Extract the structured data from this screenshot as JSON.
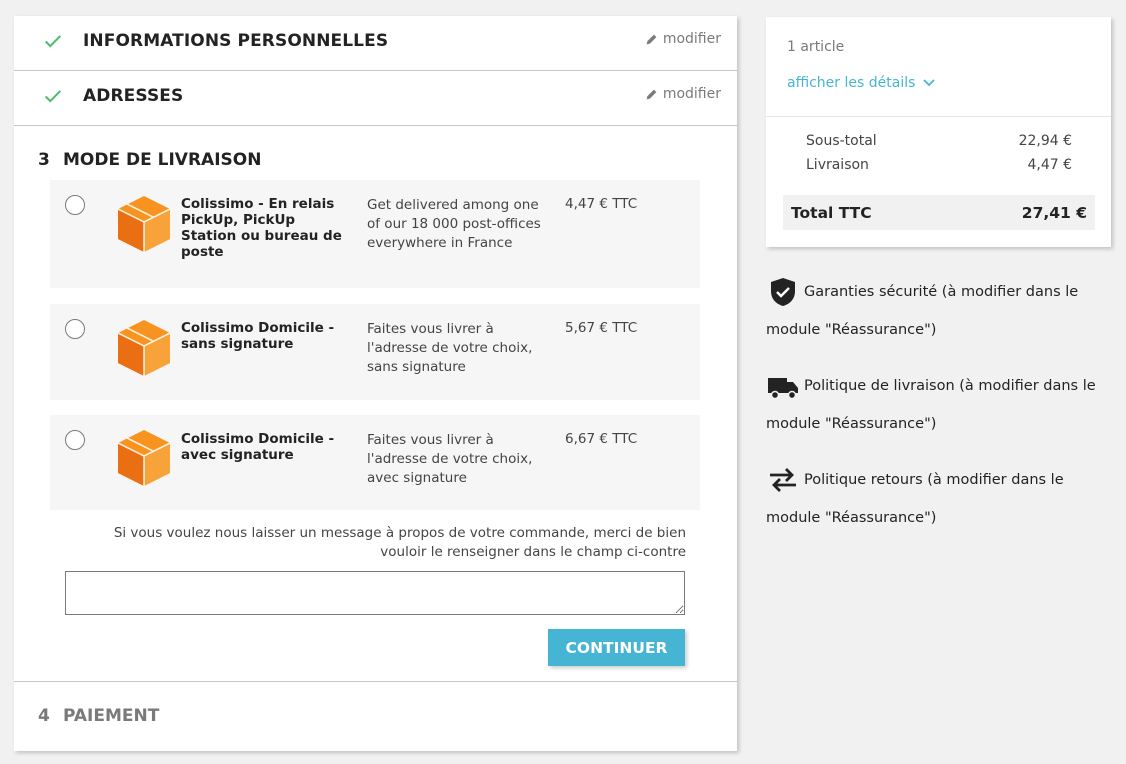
{
  "steps": {
    "personal": {
      "title": "INFORMATIONS PERSONNELLES",
      "edit_label": "modifier"
    },
    "addresses": {
      "title": "ADRESSES",
      "edit_label": "modifier"
    },
    "delivery": {
      "number": "3",
      "title": "MODE DE LIVRAISON"
    },
    "payment": {
      "number": "4",
      "title": "PAIEMENT"
    }
  },
  "carriers": [
    {
      "name": "Colissimo - En relais PickUp, PickUp Station ou bureau de poste",
      "description": "Get delivered among one of our 18 000 post-offices everywhere in France",
      "price": "4,47 € TTC"
    },
    {
      "name": "Colissimo Domicile - sans signature",
      "description": "Faites vous livrer à l'adresse de votre choix, sans signature",
      "price": "5,67 € TTC"
    },
    {
      "name": "Colissimo Domicile - avec signature",
      "description": "Faites vous livrer à l'adresse de votre choix, avec signature",
      "price": "6,67 € TTC"
    }
  ],
  "message": {
    "label": "Si vous voulez nous laisser un message à propos de votre commande, merci de bien vouloir le renseigner dans le champ ci-contre",
    "value": ""
  },
  "continue_label": "CONTINUER",
  "cart": {
    "count": "1 article",
    "details_label": "afficher les détails",
    "subtotal_label": "Sous-total",
    "subtotal_value": "22,94 €",
    "shipping_label": "Livraison",
    "shipping_value": "4,47 €",
    "total_label": "Total TTC",
    "total_value": "27,41 €"
  },
  "reassurance": [
    {
      "icon": "shield-check-icon",
      "text": "Garanties sécurité (à modifier dans le module \"Réassurance\")"
    },
    {
      "icon": "truck-icon",
      "text": "Politique de livraison (à modifier dans le module \"Réassurance\")"
    },
    {
      "icon": "swap-arrows-icon",
      "text": "Politique retours (à modifier dans le module \"Réassurance\")"
    }
  ],
  "colors": {
    "accent": "#45b5d3",
    "check": "#4cbb6c",
    "carrier_logo": "#f7931e"
  }
}
